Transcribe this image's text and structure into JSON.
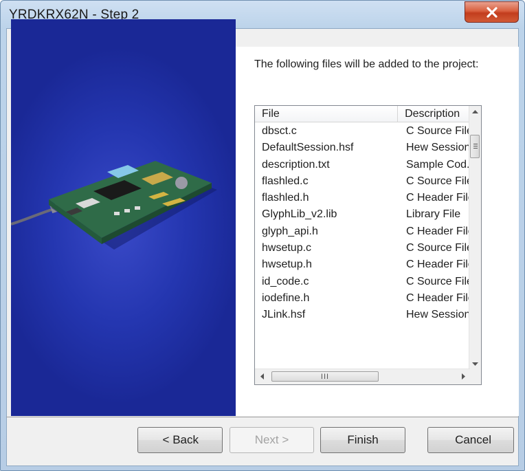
{
  "window": {
    "title": "YRDKRX62N - Step 2"
  },
  "intro_text": "The following files will be added to the project:",
  "file_list": {
    "columns": [
      "File",
      "Description"
    ],
    "rows": [
      {
        "file": "dbsct.c",
        "description": "C Source File"
      },
      {
        "file": "DefaultSession.hsf",
        "description": "Hew Session"
      },
      {
        "file": "description.txt",
        "description": "Sample Cod.."
      },
      {
        "file": "flashled.c",
        "description": "C Source File"
      },
      {
        "file": "flashled.h",
        "description": "C Header File"
      },
      {
        "file": "GlyphLib_v2.lib",
        "description": "Library File"
      },
      {
        "file": "glyph_api.h",
        "description": "C Header File"
      },
      {
        "file": "hwsetup.c",
        "description": "C Source File"
      },
      {
        "file": "hwsetup.h",
        "description": "C Header File"
      },
      {
        "file": "id_code.c",
        "description": "C Source File"
      },
      {
        "file": "iodefine.h",
        "description": "C Header File"
      },
      {
        "file": "JLink.hsf",
        "description": "Hew Session"
      }
    ],
    "hscroll_grip": "III"
  },
  "buttons": {
    "back": "< Back",
    "next": "Next >",
    "finish": "Finish",
    "cancel": "Cancel"
  },
  "icons": {
    "close": "close-x-icon",
    "scroll_up": "arrow-up-icon",
    "scroll_down": "arrow-down-icon",
    "scroll_left": "arrow-left-icon",
    "scroll_right": "arrow-right-icon"
  },
  "colors": {
    "side_panel": "#2436b0",
    "close_button": "#d25a35",
    "pcb_green": "#2f6b48"
  }
}
